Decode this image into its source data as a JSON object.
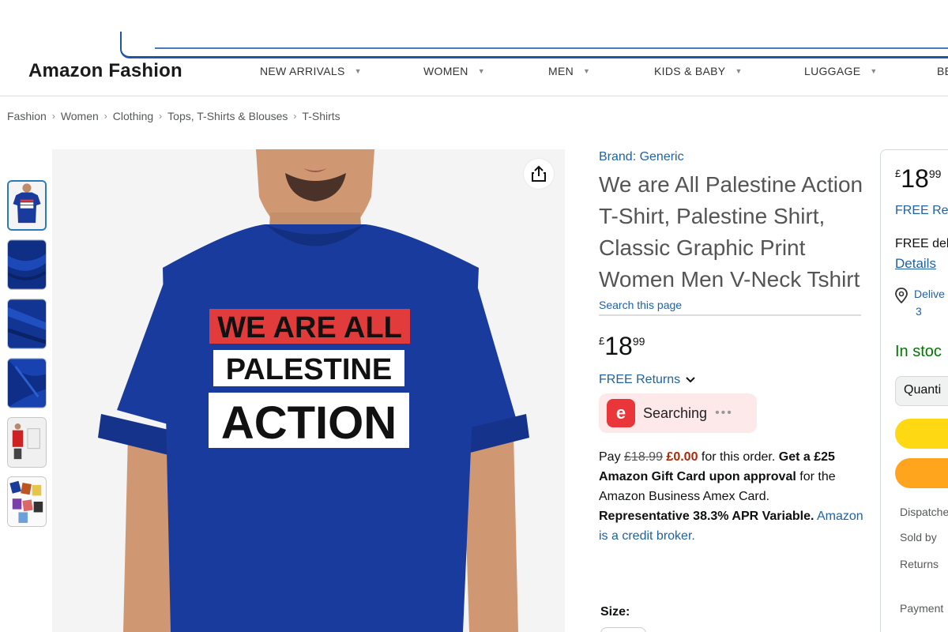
{
  "header": {
    "brand": "Amazon Fashion",
    "nav": [
      "NEW ARRIVALS",
      "WOMEN",
      "MEN",
      "KIDS & BABY",
      "LUGGAGE",
      "BE"
    ]
  },
  "breadcrumb": [
    "Fashion",
    "Women",
    "Clothing",
    "Tops, T-Shirts & Blouses",
    "T-Shirts"
  ],
  "gallery": {
    "shirt_lines": [
      "WE ARE ALL",
      "PALESTINE",
      "ACTION"
    ],
    "colors": {
      "shirt": "#1a3b9e",
      "red_banner": "#e23b3b",
      "skin": "#d29b77"
    }
  },
  "product": {
    "brand_link": "Brand: Generic",
    "title": "We are All Palestine Action T-Shirt, Palestine Shirt, Classic Graphic Print Women Men V-Neck Tshirt",
    "search_page": "Search this page",
    "price": {
      "symbol": "£",
      "whole": "18",
      "fraction": "99"
    },
    "free_returns": "FREE Returns",
    "searching": {
      "logo": "e",
      "label": "Searching"
    },
    "offer": {
      "pay": "Pay",
      "old_price": "£18.99",
      "new_price": "£0.00",
      "for_order": "for this order.",
      "gift_card": "Get a £25 Amazon Gift Card upon approval",
      "amex": "for the Amazon Business Amex Card.",
      "apr": "Representative 38.3% APR Variable.",
      "broker": "Amazon is a credit broker."
    },
    "size_label": "Size:"
  },
  "buybox": {
    "price": {
      "symbol": "£",
      "whole": "18",
      "fraction": "99"
    },
    "returns": "FREE Ret",
    "delivery": "FREE del",
    "details": "Details",
    "deliver_to": "Delive",
    "deliver_to_2": "3",
    "stock": "In stoc",
    "quantity": "Quanti",
    "dispatch": "Dispatche",
    "sold_by": "Sold by",
    "returns_row": "Returns",
    "payment": "Payment"
  }
}
